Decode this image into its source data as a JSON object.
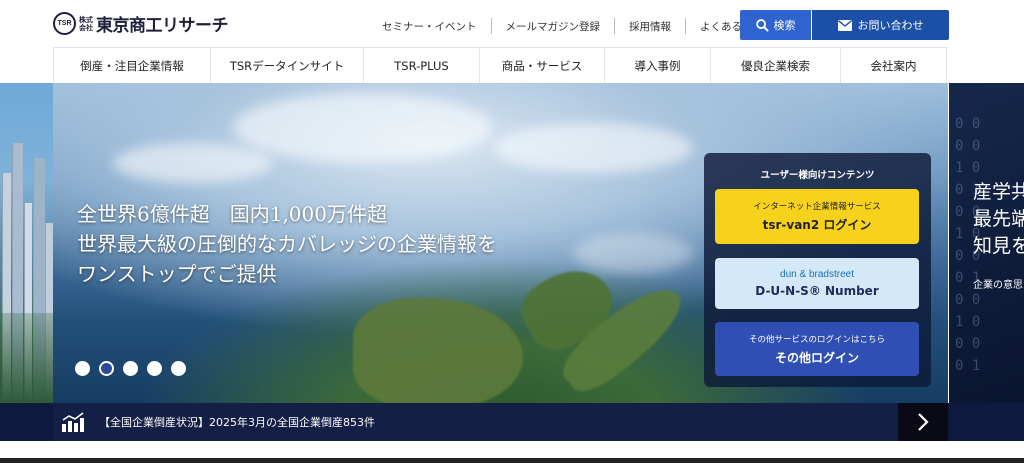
{
  "header": {
    "logo_mark": "TSR",
    "logo_small_1": "株式",
    "logo_small_2": "会社",
    "logo_text": "東京商工リサーチ",
    "util_links": [
      "セミナー・イベント",
      "メールマガジン登録",
      "採用情報",
      "よくあるご質問"
    ],
    "search_label": "検索",
    "contact_label": "お問い合わせ"
  },
  "nav": {
    "items": [
      "倒産・注目企業情報",
      "TSRデータインサイト",
      "TSR-PLUS",
      "商品・サービス",
      "導入事例",
      "優良企業検索",
      "会社案内"
    ]
  },
  "hero": {
    "line1": "全世界6億件超　国内1,000万件超",
    "line2": "世界最大級の圧倒的なカバレッジの企業情報を",
    "line3": "ワンストップでご提供",
    "slide_count": 5,
    "active_slide": 2
  },
  "panel": {
    "title": "ユーザー様向けコンテンツ",
    "btn1_sub": "インターネット企業情報サービス",
    "btn1_main": "tsr-van2 ログイン",
    "btn2_sub": "dun & bradstreet",
    "btn2_main": "D-U-N-S® Number",
    "btn3_sub": "その他サービスのログインはこちら",
    "btn3_main": "その他ログイン"
  },
  "next_slide": {
    "title_1": "産学共",
    "title_2": "最先端",
    "title_3": "知見を",
    "sub": "企業の意思"
  },
  "news": {
    "text": "【全国企業倒産状況】2025年3月の全国企業倒産853件"
  },
  "colors": {
    "search_button": "#2f63d0",
    "contact_button": "#1c4fa6",
    "tsr_van2_button": "#f6d21c",
    "duns_button": "#d3e9f7",
    "other_login_button": "#2f4fb5",
    "news_bar": "#131f45"
  },
  "icons": {
    "search": "search-icon",
    "contact": "mail-icon",
    "news": "chart-bars-icon",
    "next": "chevron-right-icon"
  }
}
